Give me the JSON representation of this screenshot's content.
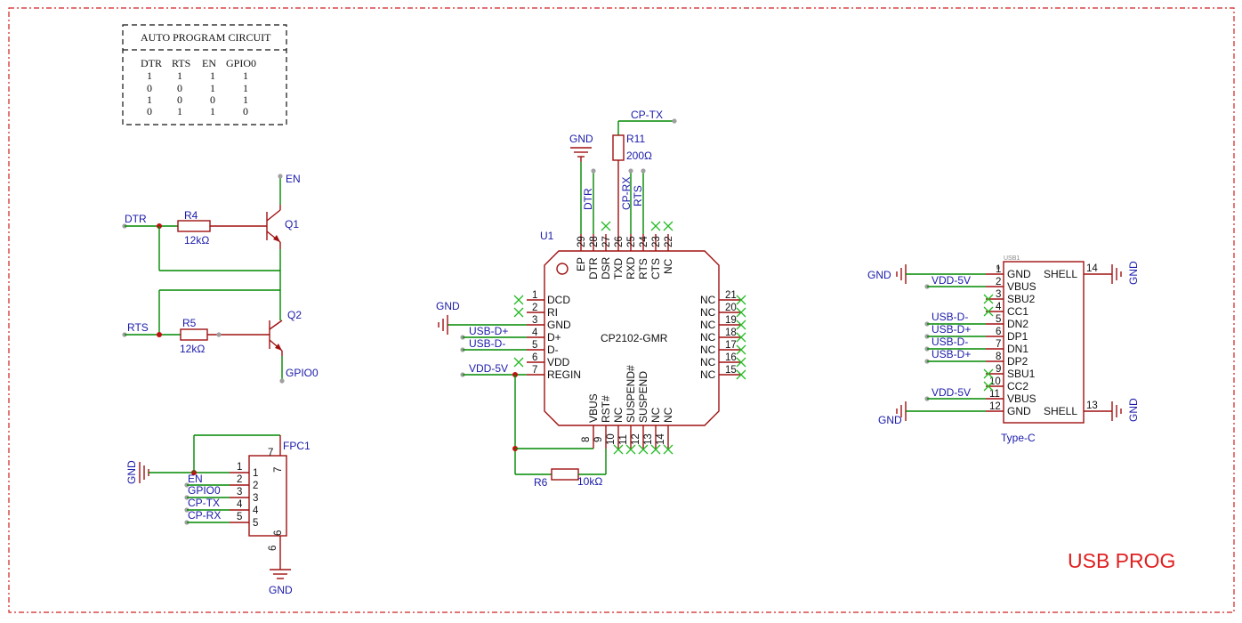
{
  "sheet_title": "USB PROG",
  "auto_program": {
    "title": "AUTO PROGRAM CIRCUIT",
    "headers": [
      "DTR",
      "RTS",
      "EN",
      "GPIO0"
    ],
    "rows": [
      [
        "1",
        "1",
        "1",
        "1"
      ],
      [
        "0",
        "0",
        "1",
        "1"
      ],
      [
        "1",
        "0",
        "0",
        "1"
      ],
      [
        "0",
        "1",
        "1",
        "0"
      ]
    ]
  },
  "transistor_circuit": {
    "nets": {
      "dtr": "DTR",
      "rts": "RTS",
      "en": "EN",
      "gpio0": "GPIO0"
    },
    "r4": {
      "ref": "R4",
      "value": "12kΩ"
    },
    "r5": {
      "ref": "R5",
      "value": "12kΩ"
    },
    "q1": "Q1",
    "q2": "Q2"
  },
  "fpc": {
    "ref": "FPC1",
    "gnd": "GND",
    "gnd_bottom": "GND",
    "nets": [
      "EN",
      "GPIO0",
      "CP-TX",
      "CP-RX"
    ],
    "pins_left": [
      "1",
      "2",
      "3",
      "4",
      "5"
    ],
    "pins_inner": [
      "1",
      "2",
      "3",
      "4",
      "5"
    ],
    "pin6": "6",
    "pin6_inner": "6",
    "pin7": "7",
    "pin7_inner": "7"
  },
  "u1": {
    "ref": "U1",
    "part": "CP2102-GMR",
    "top_pins": [
      {
        "num": "29",
        "name": "EP"
      },
      {
        "num": "28",
        "name": "DTR"
      },
      {
        "num": "27",
        "name": "DSR"
      },
      {
        "num": "26",
        "name": "TXD"
      },
      {
        "num": "25",
        "name": "RXD"
      },
      {
        "num": "24",
        "name": "RTS"
      },
      {
        "num": "23",
        "name": "CTS"
      },
      {
        "num": "22",
        "name": "NC"
      }
    ],
    "left_pins": [
      {
        "num": "1",
        "name": "DCD"
      },
      {
        "num": "2",
        "name": "RI"
      },
      {
        "num": "3",
        "name": "GND"
      },
      {
        "num": "4",
        "name": "D+"
      },
      {
        "num": "5",
        "name": "D-"
      },
      {
        "num": "6",
        "name": "VDD"
      },
      {
        "num": "7",
        "name": "REGIN"
      }
    ],
    "right_pins": [
      {
        "num": "21",
        "name": "NC"
      },
      {
        "num": "20",
        "name": "NC"
      },
      {
        "num": "19",
        "name": "NC"
      },
      {
        "num": "18",
        "name": "NC"
      },
      {
        "num": "17",
        "name": "NC"
      },
      {
        "num": "16",
        "name": "NC"
      },
      {
        "num": "15",
        "name": "NC"
      }
    ],
    "bottom_pins": [
      {
        "num": "8",
        "name": "VBUS"
      },
      {
        "num": "9",
        "name": "RST#"
      },
      {
        "num": "10",
        "name": "NC"
      },
      {
        "num": "11",
        "name": "SUSPEND#"
      },
      {
        "num": "12",
        "name": "SUSPEND"
      },
      {
        "num": "13",
        "name": "NC"
      },
      {
        "num": "14",
        "name": "NC"
      }
    ],
    "nets": {
      "gnd_top": "GND",
      "dtr": "DTR",
      "cp_rx": "CP-RX",
      "rts": "RTS",
      "cp_tx": "CP-TX",
      "gnd_left": "GND",
      "usb_dp": "USB-D+",
      "usb_dm": "USB-D-",
      "vdd": "VDD-5V"
    },
    "r11": {
      "ref": "R11",
      "value": "200Ω"
    },
    "r6": {
      "ref": "R6",
      "value": "10kΩ"
    }
  },
  "usb1": {
    "ref": "USB1",
    "part": "Type-C",
    "pins": [
      {
        "num": "1",
        "name": "GND"
      },
      {
        "num": "2",
        "name": "VBUS"
      },
      {
        "num": "3",
        "name": "SBU2"
      },
      {
        "num": "4",
        "name": "CC1"
      },
      {
        "num": "5",
        "name": "DN2"
      },
      {
        "num": "6",
        "name": "DP1"
      },
      {
        "num": "7",
        "name": "DN1"
      },
      {
        "num": "8",
        "name": "DP2"
      },
      {
        "num": "9",
        "name": "SBU1"
      },
      {
        "num": "10",
        "name": "CC2"
      },
      {
        "num": "11",
        "name": "VBUS"
      },
      {
        "num": "12",
        "name": "GND"
      }
    ],
    "shell_top": {
      "num": "14",
      "name": "SHELL"
    },
    "shell_bottom": {
      "num": "13",
      "name": "SHELL"
    },
    "nets": {
      "gnd1": "GND",
      "vdd1": "VDD-5V",
      "dn2": "USB-D-",
      "dp1": "USB-D+",
      "dn1": "USB-D-",
      "dp2": "USB-D+",
      "vdd2": "VDD-5V",
      "gnd2": "GND",
      "gnd_r1": "GND",
      "gnd_r2": "GND"
    }
  }
}
